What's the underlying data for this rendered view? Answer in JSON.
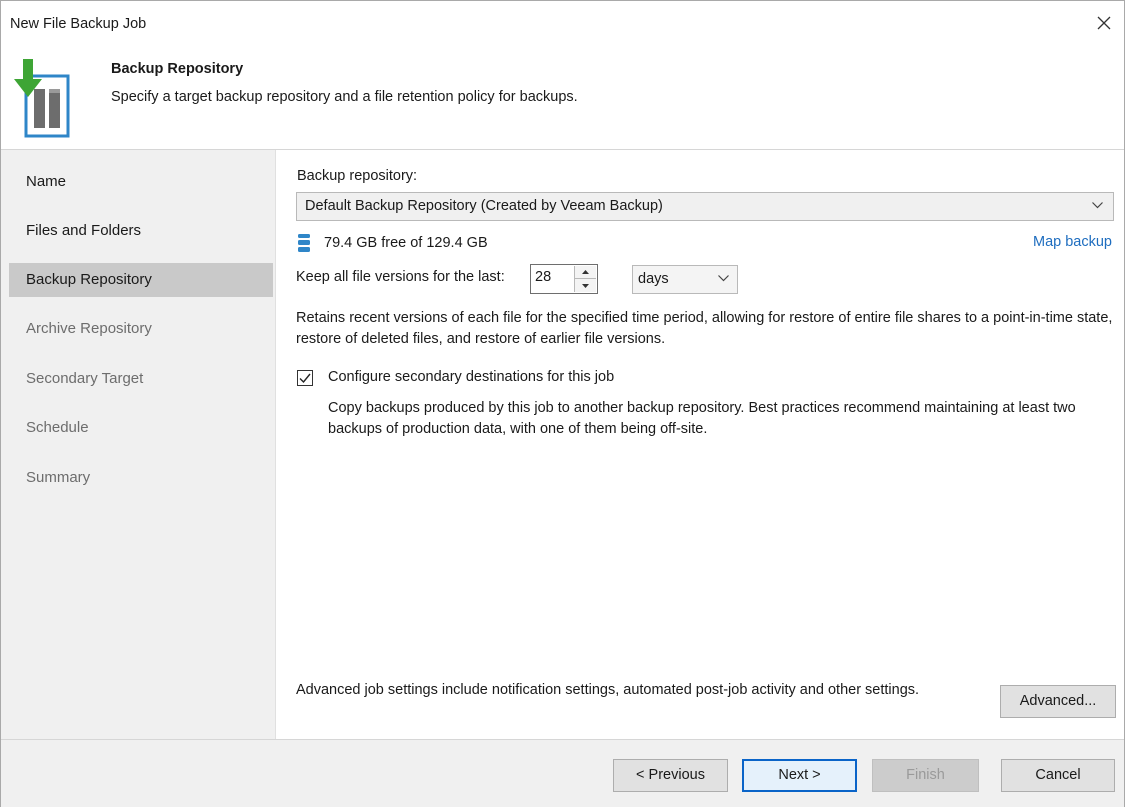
{
  "window": {
    "title": "New File Backup Job"
  },
  "header": {
    "title": "Backup Repository",
    "subtitle": "Specify a target backup repository and a file retention policy for backups."
  },
  "sidebar": {
    "items": [
      {
        "label": "Name",
        "state": "done"
      },
      {
        "label": "Files and Folders",
        "state": "done"
      },
      {
        "label": "Backup Repository",
        "state": "active"
      },
      {
        "label": "Archive Repository",
        "state": "pending"
      },
      {
        "label": "Secondary Target",
        "state": "pending"
      },
      {
        "label": "Schedule",
        "state": "pending"
      },
      {
        "label": "Summary",
        "state": "pending"
      }
    ]
  },
  "main": {
    "repo_label": "Backup repository:",
    "repo_value": "Default Backup Repository (Created by Veeam Backup)",
    "free_space": "79.4 GB free of 129.4 GB",
    "map_backup": "Map backup",
    "keep_label": "Keep all file versions for the last:",
    "keep_value": "28",
    "keep_unit": "days",
    "retains_text": "Retains recent versions of each file for the specified time period, allowing for restore of entire file shares to a point-in-time state, restore of deleted files, and restore of earlier file versions.",
    "secondary_checked": true,
    "secondary_label": "Configure secondary destinations for this job",
    "secondary_desc": "Copy backups produced by this job to another backup repository. Best practices recommend maintaining at least two backups of production data, with one of them being off-site.",
    "advanced_text": "Advanced job settings include notification settings, automated post-job activity and other settings.",
    "advanced_button": "Advanced..."
  },
  "footer": {
    "previous": "< Previous",
    "next": "Next >",
    "finish": "Finish",
    "cancel": "Cancel"
  },
  "colors": {
    "accent": "#0a64c8",
    "link": "#1e6dbf",
    "sidebar_bg": "#f0f0f0",
    "active_item": "#c9c9c9",
    "logo_green": "#3ea535",
    "logo_blue": "#2f86c8"
  }
}
